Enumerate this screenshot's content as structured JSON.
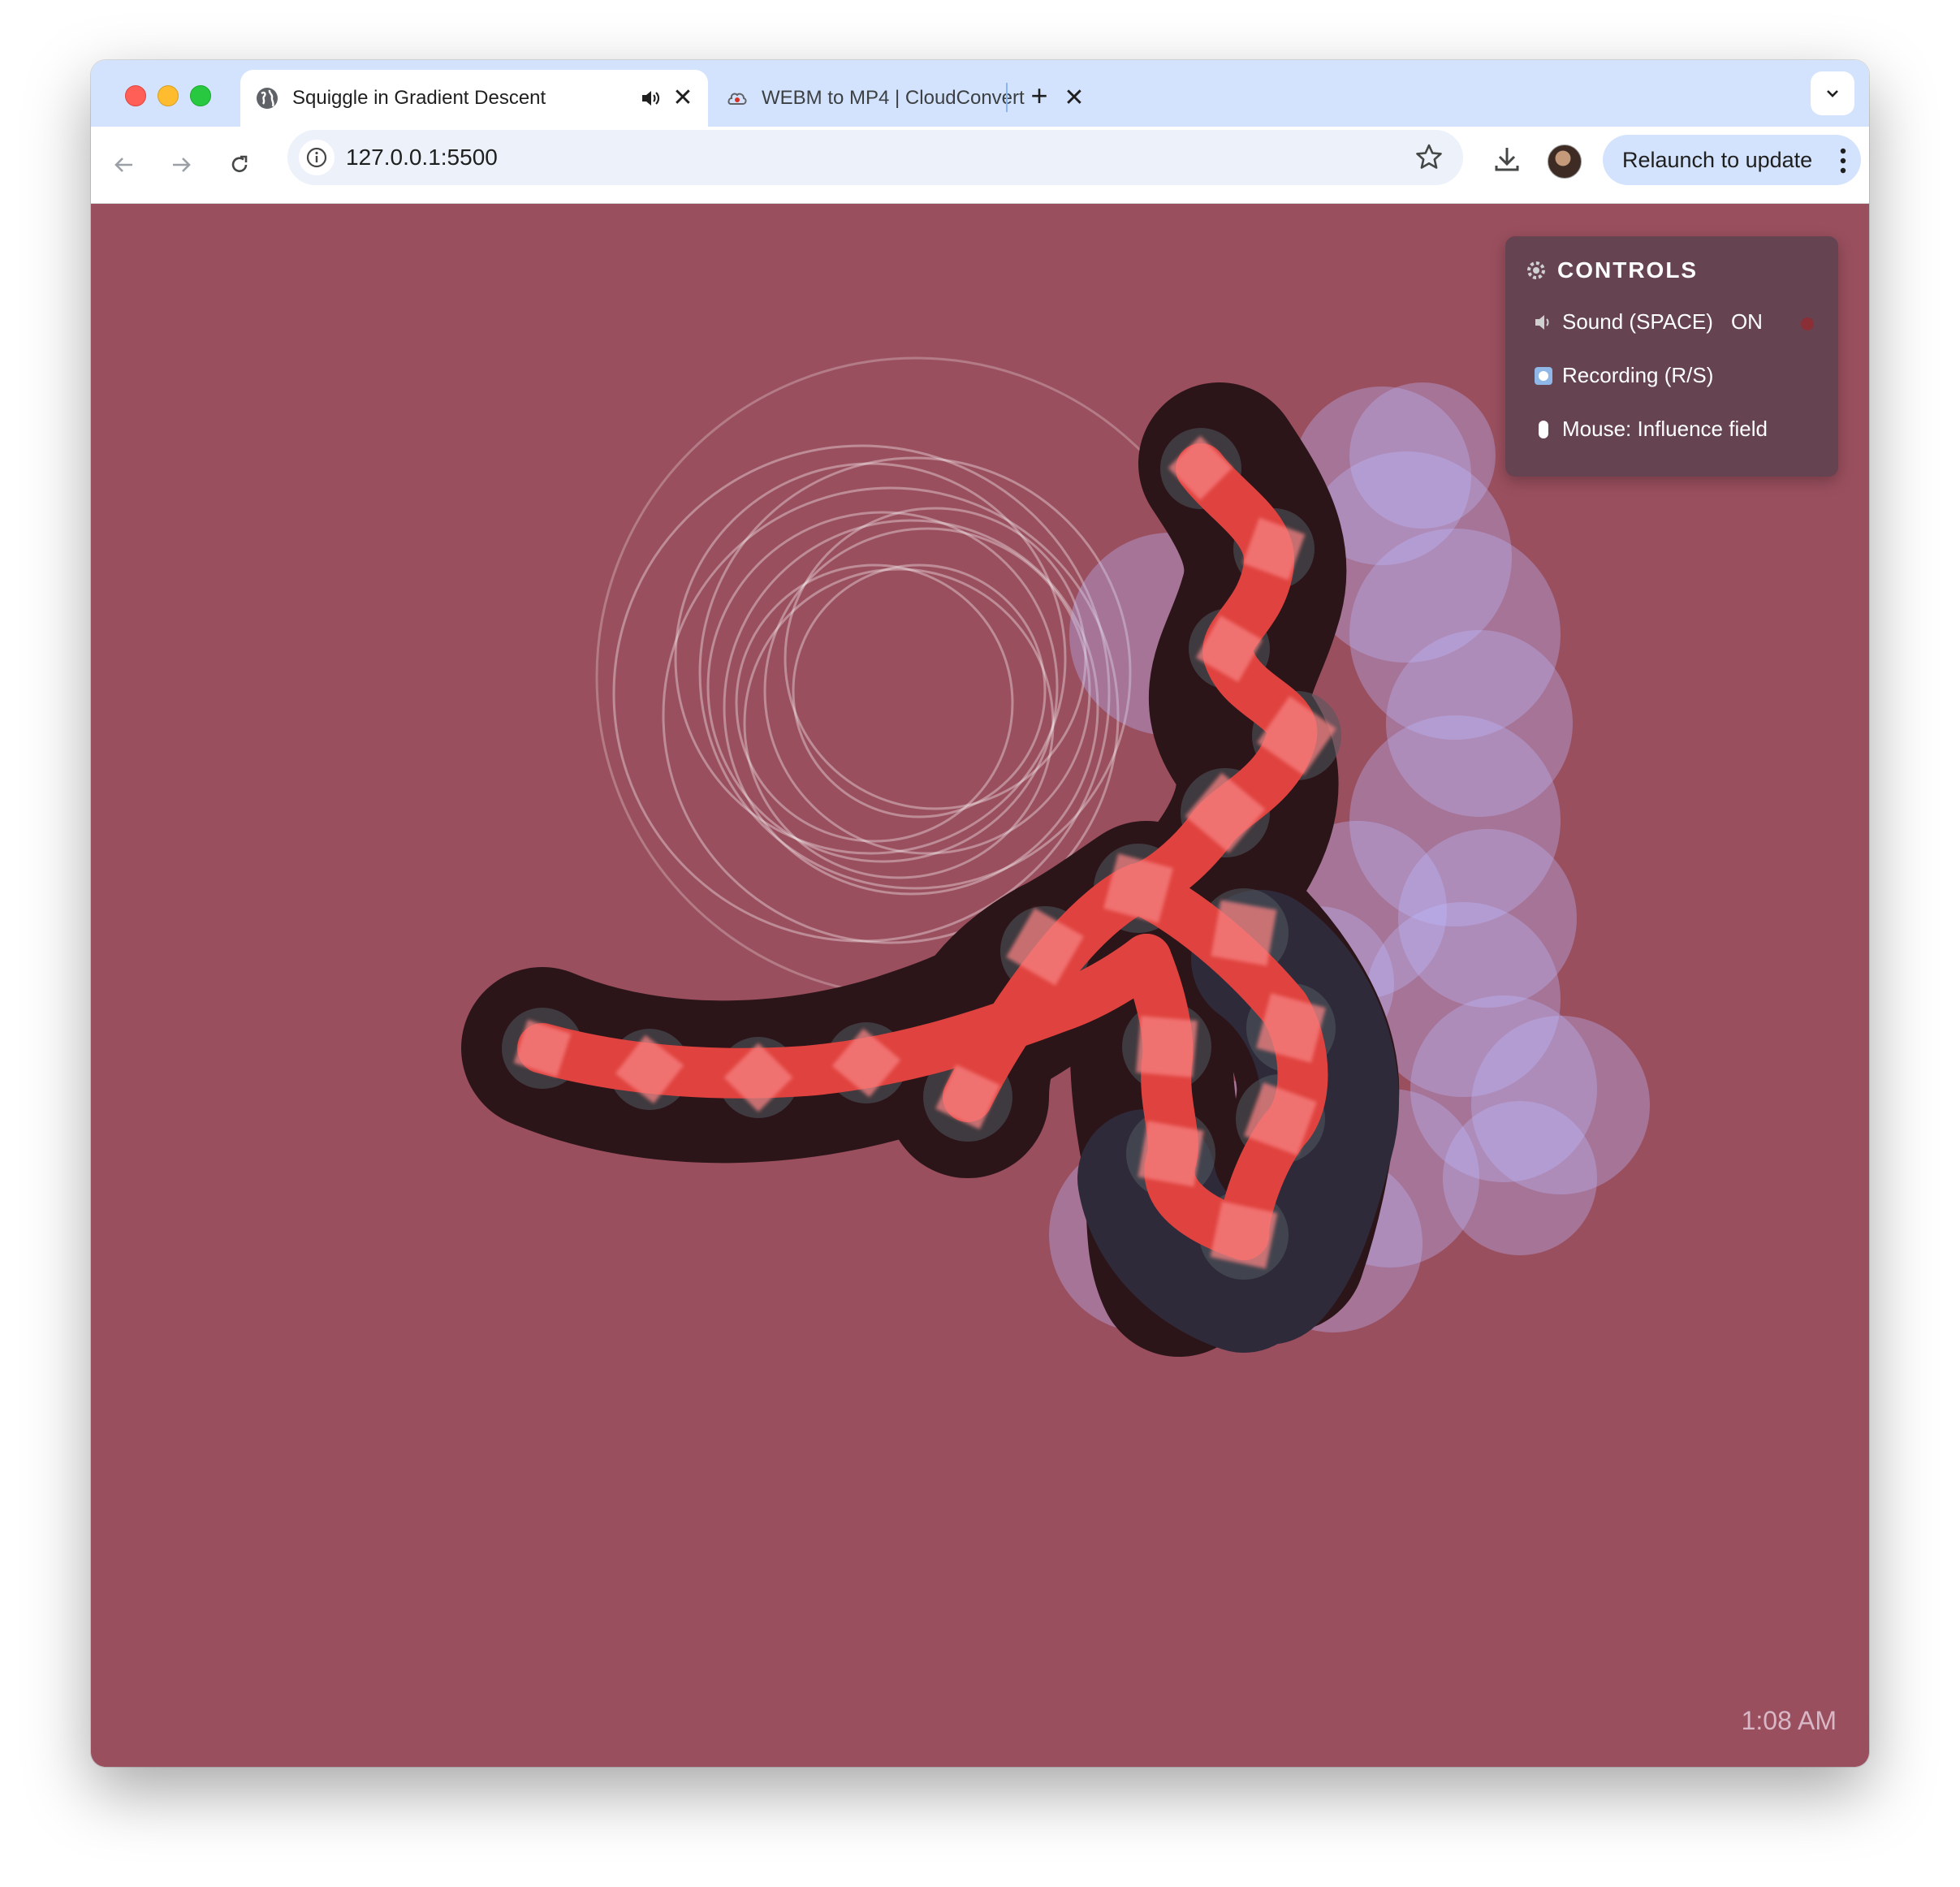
{
  "browser": {
    "tabs": [
      {
        "title": "Squiggle in Gradient Descent",
        "active": true,
        "audio": true
      },
      {
        "title": "WEBM to MP4 | CloudConvert",
        "active": false
      }
    ],
    "url": "127.0.0.1:5500",
    "relaunch_label": "Relaunch to update"
  },
  "controls": {
    "title": "CONTROLS",
    "items": [
      {
        "label": "Sound (SPACE)",
        "state": "ON",
        "icon": "speaker-icon"
      },
      {
        "label": "Recording (R/S)",
        "icon": "record-icon"
      },
      {
        "label": "Mouse: Influence field",
        "icon": "mouse-icon"
      }
    ]
  },
  "clock": "1:08 AM",
  "colors": {
    "canvas_bg": "#9a4f5e",
    "squiggle_core": "#e8534f",
    "squiggle_shadow": "#2a1418",
    "field_blobs": "#b9b7ff",
    "tab_strip": "#d3e3fd"
  }
}
